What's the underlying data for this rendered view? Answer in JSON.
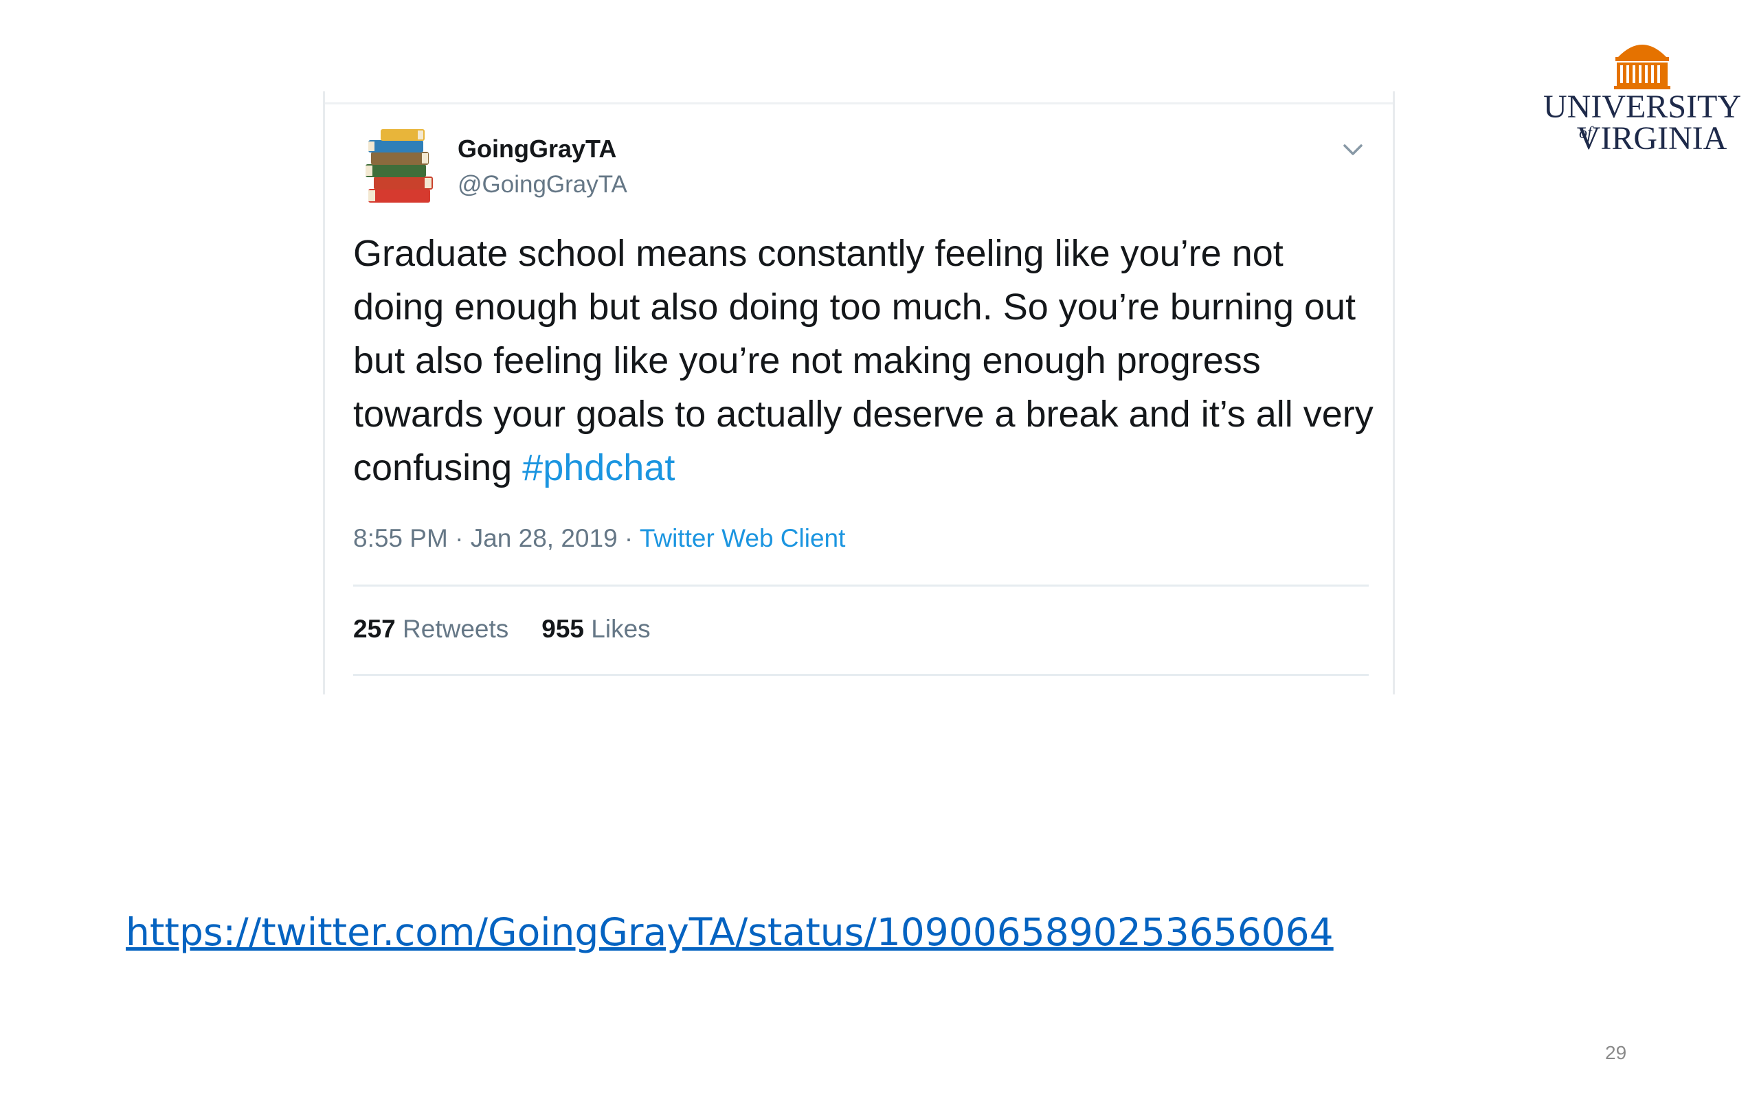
{
  "tweet": {
    "display_name": "GoingGrayTA",
    "handle": "@GoingGrayTA",
    "text_before_hashtag": "Graduate school means constantly feeling like you’re not doing enough but also doing too much. So you’re burning out but also feeling like you’re not making enough progress towards your goals to actually deserve a break and it’s all very confusing ",
    "hashtag": "#phdchat",
    "time": "8:55 PM",
    "separator": " · ",
    "date": "Jan 28, 2019",
    "client": "Twitter Web Client",
    "retweets_count": "257",
    "retweets_label": "Retweets",
    "likes_count": "955",
    "likes_label": "Likes"
  },
  "logo": {
    "line1": "UNIVERSITY",
    "of": "of",
    "line2": "VIRGINIA",
    "brand_color": "#e57200"
  },
  "source_link": "https://twitter.com/GoingGrayTA/status/1090065890253656064",
  "page_number": "29",
  "colors": {
    "text": "#14171a",
    "muted": "#657786",
    "twitter_blue": "#1b95e0",
    "link": "#0563c1"
  }
}
